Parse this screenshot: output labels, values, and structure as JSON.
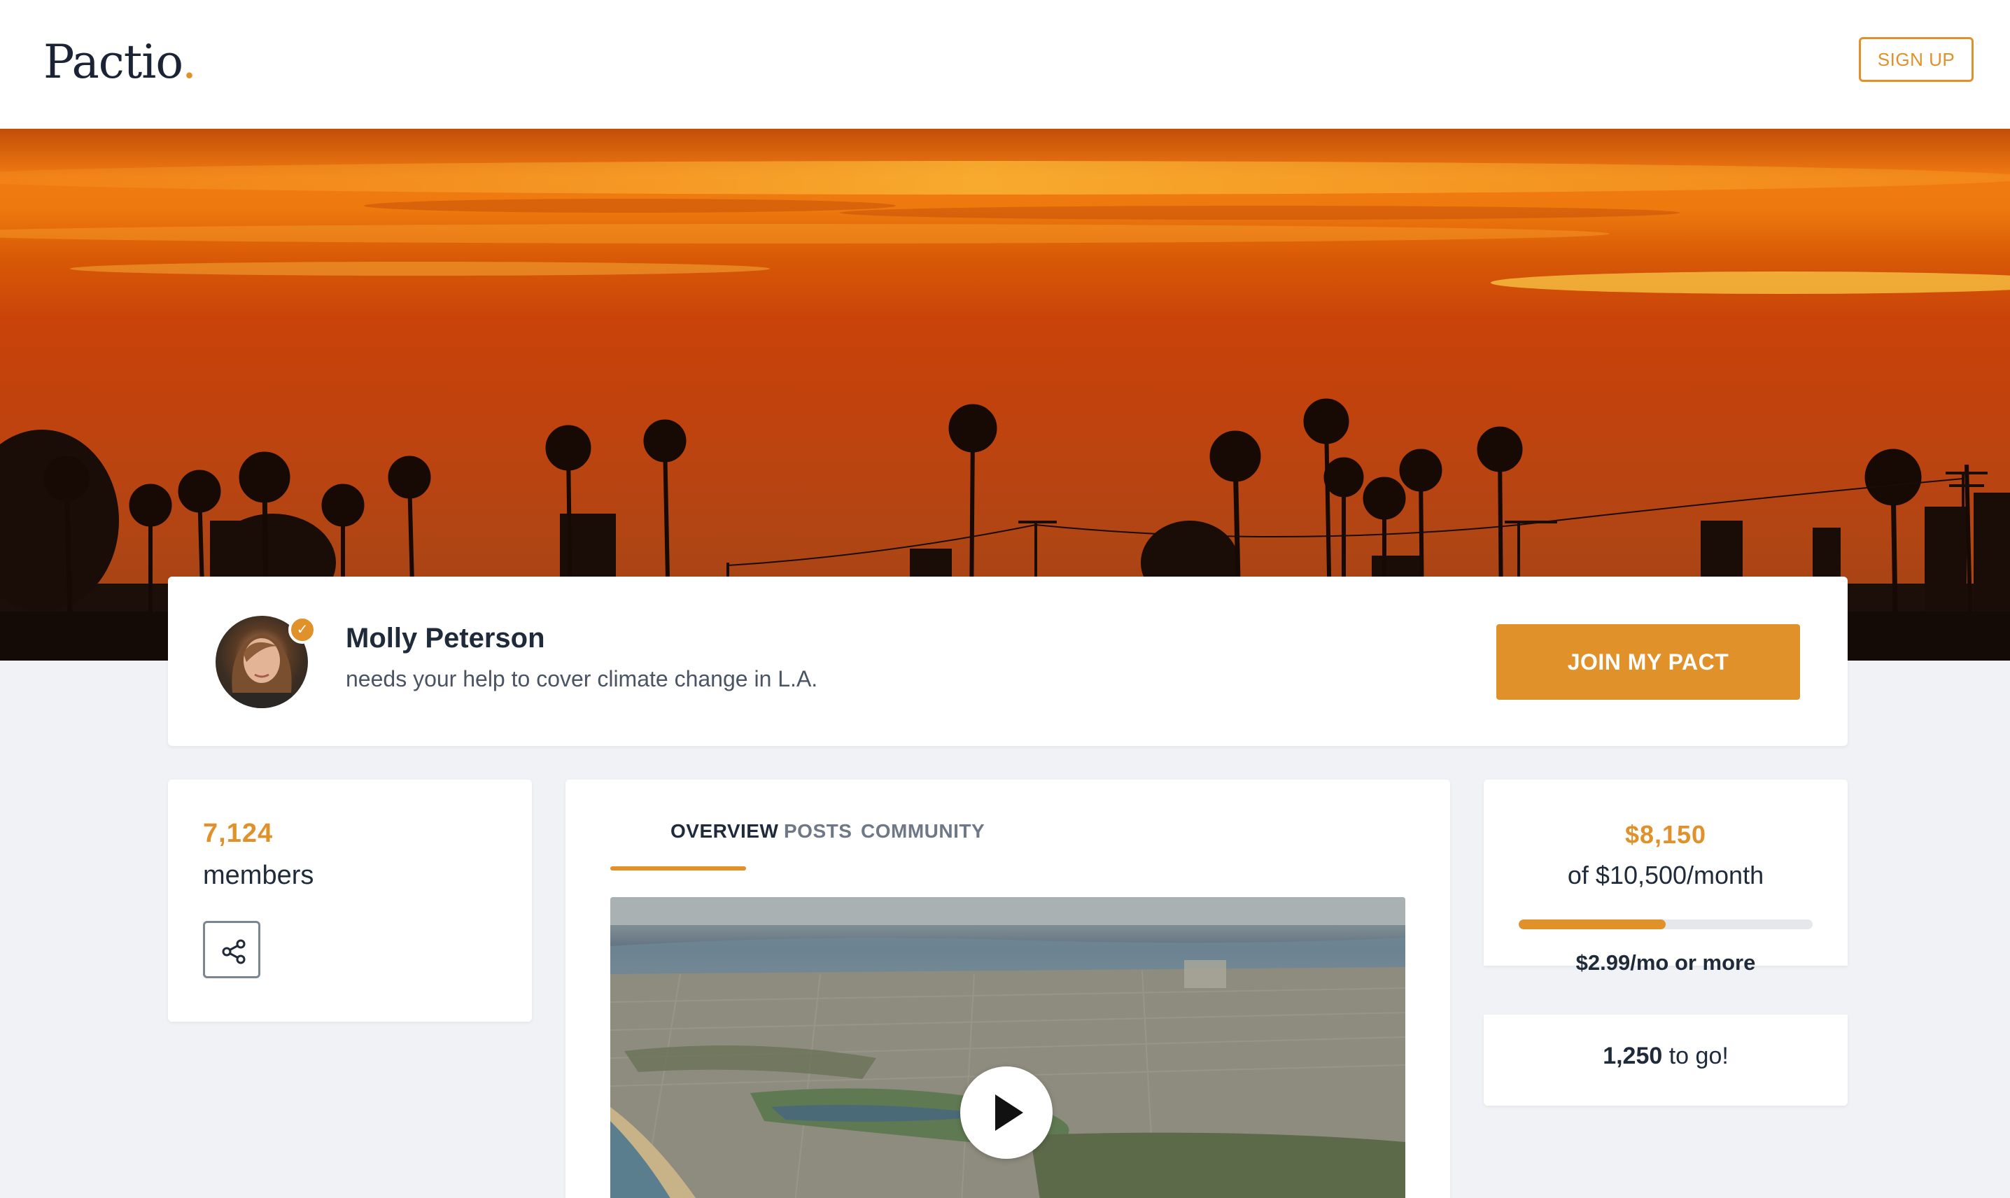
{
  "header": {
    "logo_text": "Pactio",
    "logo_dot": ".",
    "signup_label": "SIGN UP"
  },
  "hero": {
    "image": "sunset-palm-trees-la"
  },
  "profile": {
    "name": "Molly Peterson",
    "tagline": "needs your help to cover climate change in L.A.",
    "verified_icon": "check-icon",
    "join_label": "JOIN MY PACT"
  },
  "members": {
    "count": "7,124",
    "label": "members",
    "share_icon": "share-icon"
  },
  "tabs": [
    {
      "label": "OVERVIEW",
      "active": true
    },
    {
      "label": "POSTS",
      "active": false
    },
    {
      "label": "COMMUNITY",
      "active": false
    }
  ],
  "video": {
    "thumbnail": "aerial-city-coast",
    "play_icon": "play-icon"
  },
  "goal": {
    "amount": "$8,150",
    "of_text": "of $10,500/month",
    "progress": 0.5,
    "min_text": "$2.99/mo or more",
    "to_go_number": "1,250",
    "to_go_suffix": " to go!"
  },
  "colors": {
    "accent": "#e0912a",
    "text": "#1f2a3a",
    "muted": "#6f7886",
    "background": "#f0f2f5"
  }
}
